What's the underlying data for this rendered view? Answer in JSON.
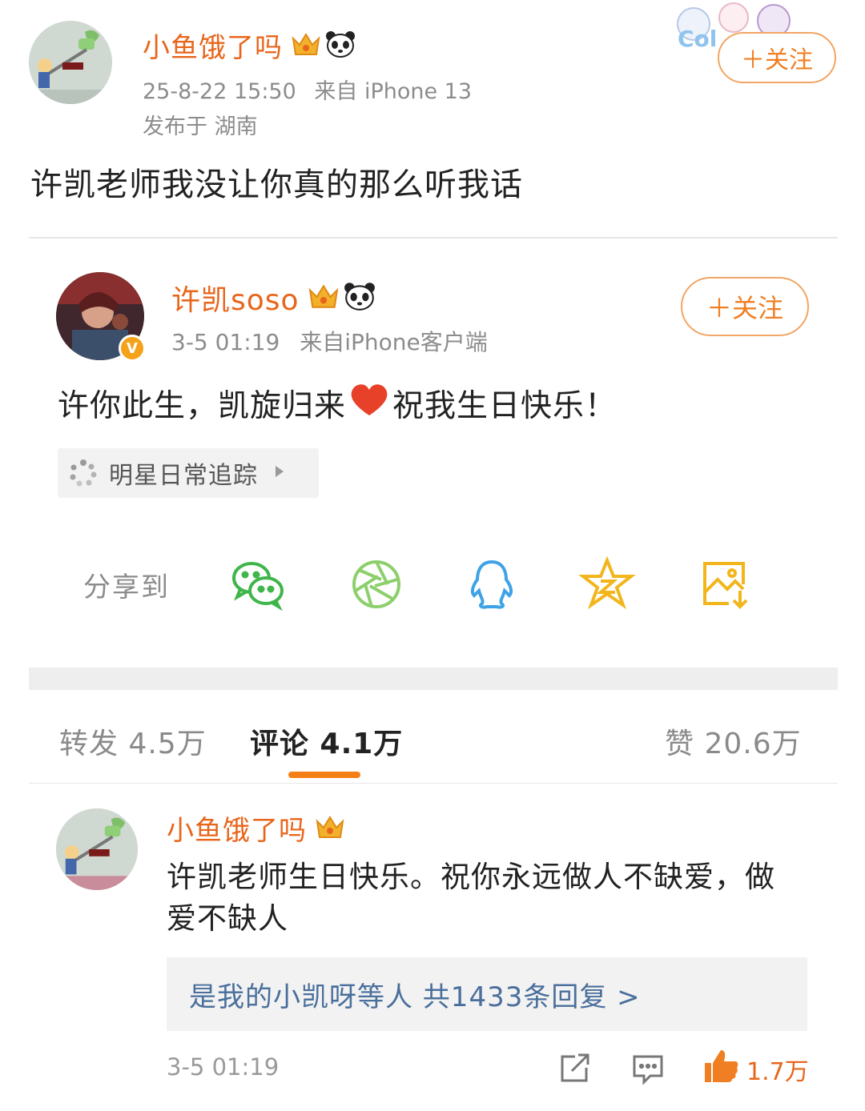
{
  "post": {
    "username": "小鱼饿了吗",
    "timestamp": "25-8-22 15:50",
    "source": "来自 iPhone 13",
    "location": "发布于 湖南",
    "follow_label": "＋关注",
    "sticker_text": "Col",
    "text": "许凯老师我没让你真的那么听我话"
  },
  "original": {
    "username": "许凯soso",
    "timestamp": "3-5 01:19",
    "source": "来自iPhone客户端",
    "follow_label": "＋关注",
    "text_before": "许你此生，凯旋归来",
    "text_after": "祝我生日快乐！",
    "topic": "明星日常追踪",
    "verified_badge": "V"
  },
  "share": {
    "label": "分享到",
    "targets": [
      "wechat-icon",
      "moments-icon",
      "qq-icon",
      "qzone-icon",
      "save-image-icon"
    ]
  },
  "tabs": {
    "repost": "转发 4.5万",
    "comment": "评论 4.1万",
    "like": "赞 20.6万"
  },
  "comment": {
    "username": "小鱼饿了吗",
    "text": "许凯老师生日快乐。祝你永远做人不缺爱，做爱不缺人",
    "reply_summary": "是我的小凯呀等人  共1433条回复 >",
    "time": "3-5 01:19",
    "likes": "1.7万"
  },
  "colors": {
    "accent": "#f07f23",
    "username": "#e8661c",
    "link": "#4a6f9c"
  }
}
